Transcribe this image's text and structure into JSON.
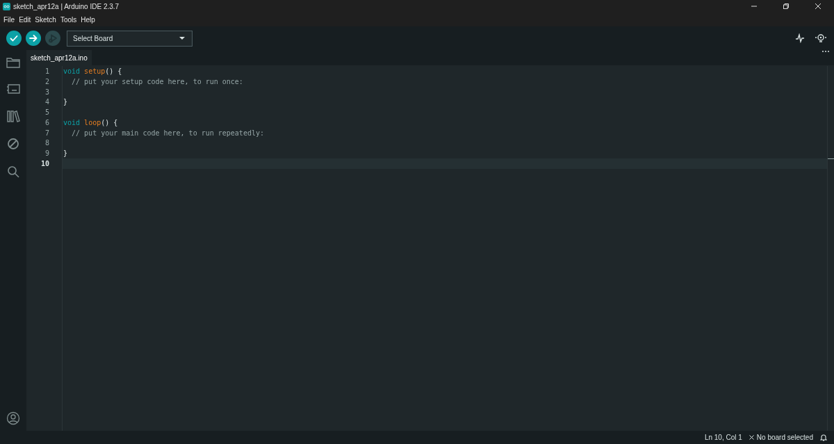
{
  "window": {
    "title": "sketch_apr12a | Arduino IDE 2.3.7"
  },
  "menu": [
    "File",
    "Edit",
    "Sketch",
    "Tools",
    "Help"
  ],
  "toolbar": {
    "buttons": [
      {
        "kind": "verify",
        "disabled": false
      },
      {
        "kind": "upload",
        "disabled": false
      },
      {
        "kind": "debug",
        "disabled": true
      }
    ],
    "board_select": {
      "value": "Select Board"
    }
  },
  "tabs": [
    {
      "label": "sketch_apr12a.ino",
      "selected": true
    }
  ],
  "editor": {
    "lines": [
      {
        "number": "1",
        "current": false,
        "tokens": [
          {
            "kind": "keyword",
            "text": "void "
          },
          {
            "kind": "function",
            "text": "setup"
          },
          {
            "kind": "plain",
            "text": "() {"
          }
        ]
      },
      {
        "number": "2",
        "current": false,
        "tokens": [
          {
            "kind": "comment",
            "text": "  // put your setup code here, to run once:"
          }
        ]
      },
      {
        "number": "3",
        "current": false
      },
      {
        "number": "4",
        "current": false,
        "tokens": [
          {
            "kind": "plain",
            "text": "}"
          }
        ]
      },
      {
        "number": "5",
        "current": false
      },
      {
        "number": "6",
        "current": false,
        "tokens": [
          {
            "kind": "keyword",
            "text": "void "
          },
          {
            "kind": "function",
            "text": "loop"
          },
          {
            "kind": "plain",
            "text": "() {"
          }
        ]
      },
      {
        "number": "7",
        "current": false,
        "tokens": [
          {
            "kind": "comment",
            "text": "  // put your main code here, to run repeatedly:"
          }
        ]
      },
      {
        "number": "8",
        "current": false
      },
      {
        "number": "9",
        "current": false,
        "tokens": [
          {
            "kind": "plain",
            "text": "}"
          }
        ]
      },
      {
        "number": "10",
        "current": true
      }
    ]
  },
  "status_bar": {
    "position": "Ln 10, Col 1",
    "board": "No board selected"
  }
}
